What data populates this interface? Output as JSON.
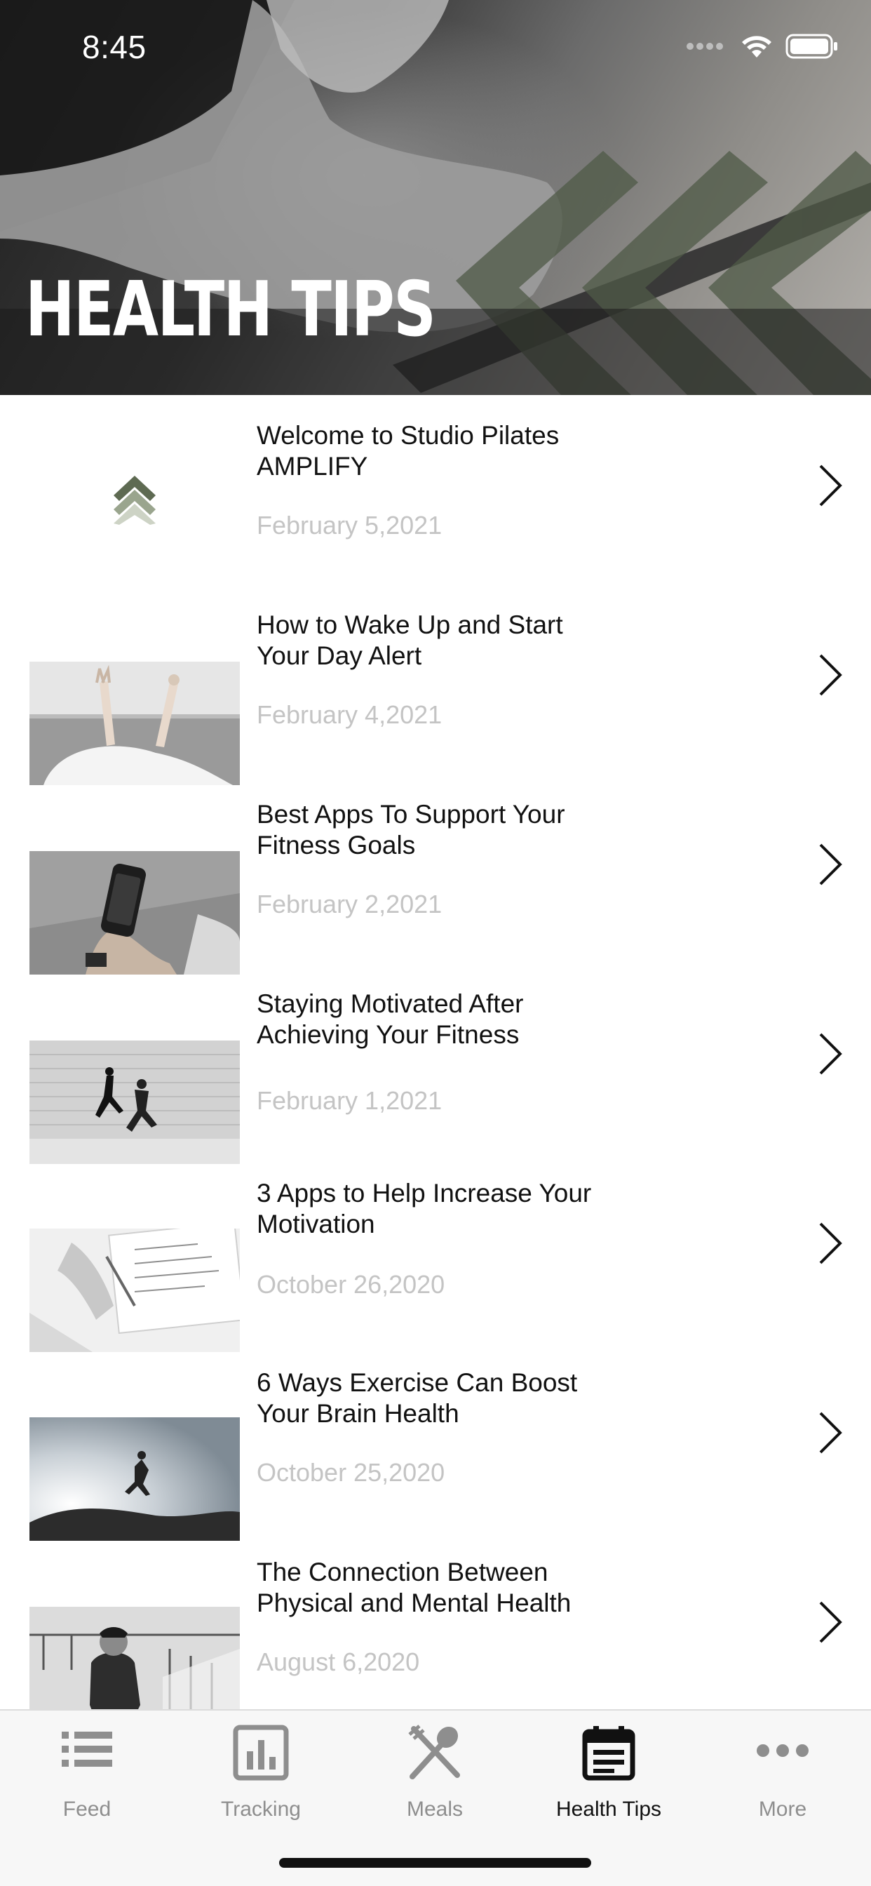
{
  "status_bar": {
    "time": "8:45"
  },
  "header": {
    "title": "HEALTH TIPS"
  },
  "articles": [
    {
      "title": "Welcome to Studio Pilates AMPLIFY",
      "date": "February 5,2021",
      "thumb": "logo-thumbnail"
    },
    {
      "title": "How to Wake Up and Start Your Day Alert",
      "date": "February 4,2021",
      "thumb": "bed-photo"
    },
    {
      "title": "Best Apps To Support Your Fitness Goals",
      "date": "February 2,2021",
      "thumb": "phone-photo"
    },
    {
      "title": "Staying Motivated After Achieving Your Fitness",
      "date": "February 1,2021",
      "thumb": "runners-photo"
    },
    {
      "title": "3 Apps to Help Increase Your Motivation",
      "date": "October 26,2020",
      "thumb": "planner-photo"
    },
    {
      "title": "6 Ways Exercise Can Boost Your Brain Health",
      "date": "October 25,2020",
      "thumb": "jumper-photo"
    },
    {
      "title": "The Connection Between Physical and Mental Health",
      "date": "August 6,2020",
      "thumb": "stairs-photo"
    }
  ],
  "tabs": [
    {
      "label": "Feed",
      "icon": "list-icon",
      "active": false
    },
    {
      "label": "Tracking",
      "icon": "bar-chart-icon",
      "active": false
    },
    {
      "label": "Meals",
      "icon": "fork-spoon-icon",
      "active": false
    },
    {
      "label": "Health Tips",
      "icon": "calendar-icon",
      "active": true
    },
    {
      "label": "More",
      "icon": "more-icon",
      "active": false
    }
  ],
  "colors": {
    "accent": "#5e6a52",
    "date_text": "#c4c4c4",
    "tab_inactive": "#8e8e8e"
  }
}
